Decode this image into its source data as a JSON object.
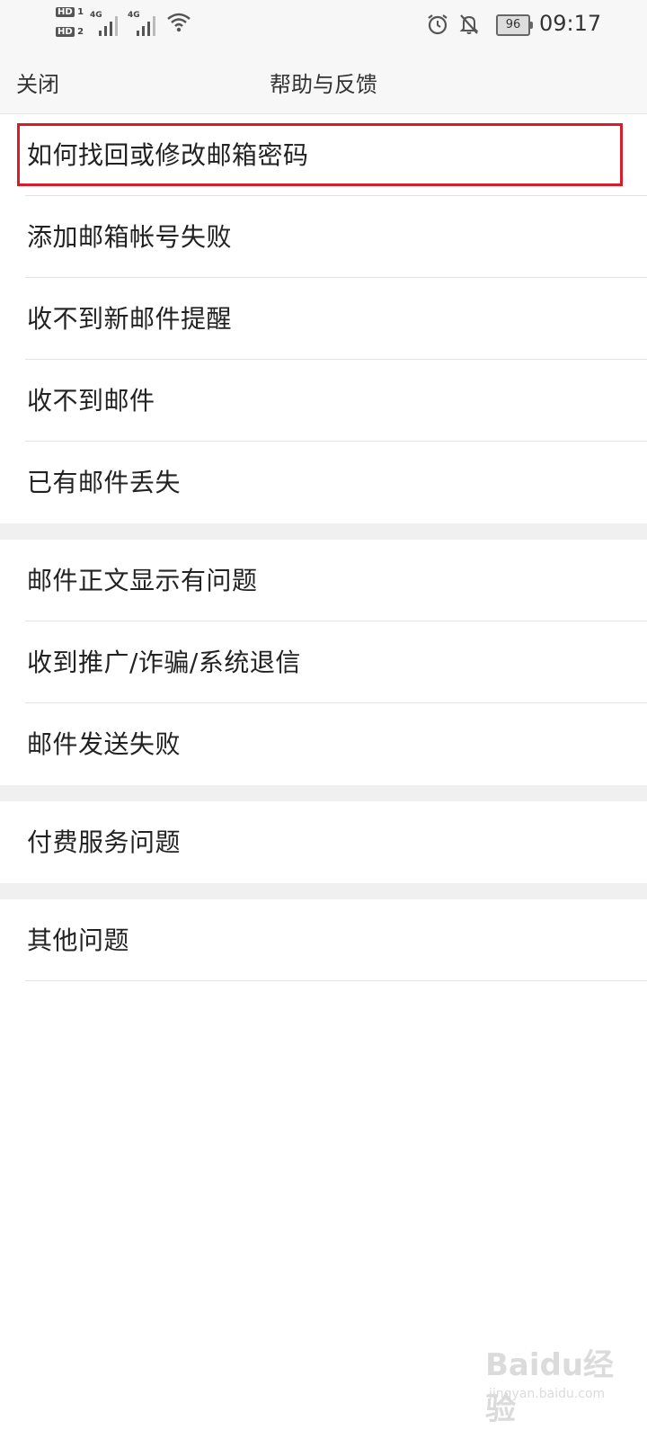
{
  "status_bar": {
    "hd1": "HD",
    "hd1_num": "1",
    "hd2": "HD",
    "hd2_num": "2",
    "net1": "4G",
    "net2": "4G",
    "battery": "96",
    "time": "09:17"
  },
  "nav": {
    "close_label": "关闭",
    "title": "帮助与反馈"
  },
  "groups": [
    {
      "items": [
        "如何找回或修改邮箱密码",
        "添加邮箱帐号失败",
        "收不到新邮件提醒",
        "收不到邮件",
        "已有邮件丢失"
      ]
    },
    {
      "items": [
        "邮件正文显示有问题",
        "收到推广/诈骗/系统退信",
        "邮件发送失败"
      ]
    },
    {
      "items": [
        "付费服务问题"
      ]
    },
    {
      "items": [
        "其他问题"
      ]
    }
  ],
  "highlight_color": "#d71c2a",
  "watermark": {
    "mark": "Baidu经验",
    "sub": "jingyan.baidu.com"
  }
}
